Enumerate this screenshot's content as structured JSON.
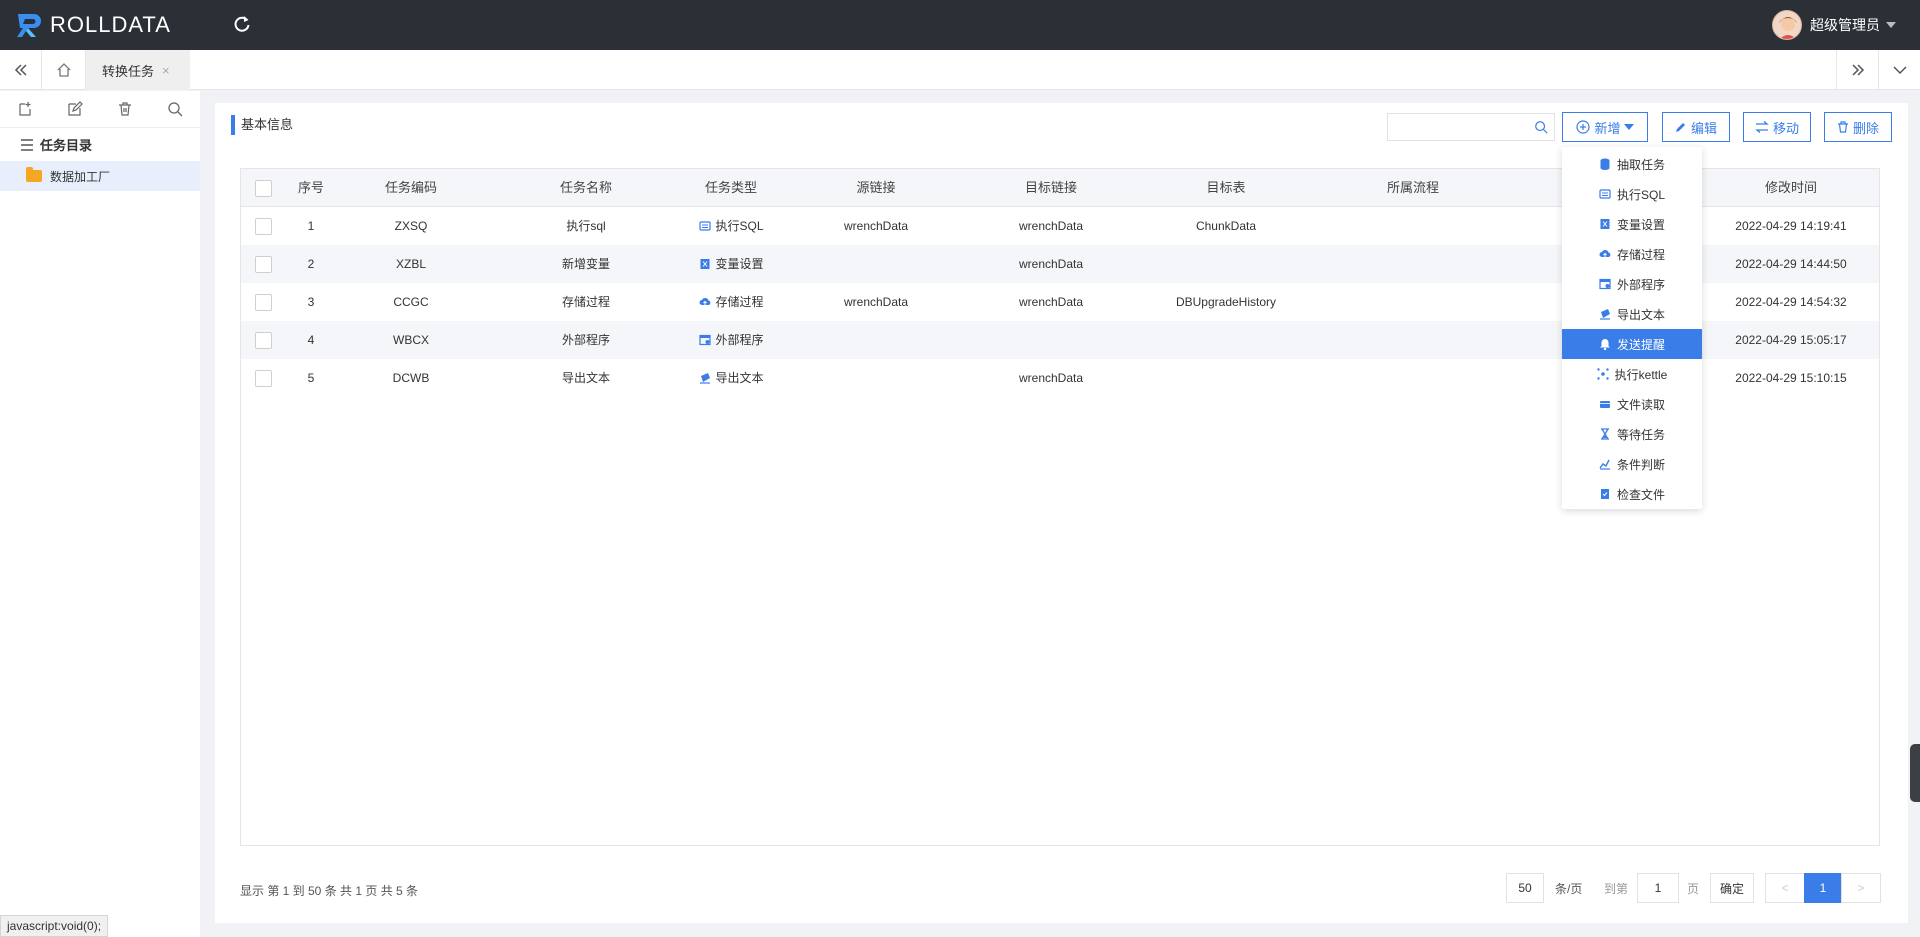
{
  "app": {
    "logo_text": "ROLLDATA",
    "user_name": "超级管理员"
  },
  "tabs": [
    {
      "label": "转换任务",
      "close": "×"
    }
  ],
  "sidebar": {
    "title": "任务目录",
    "items": [
      {
        "label": "数据加工厂"
      }
    ]
  },
  "panel": {
    "section_title": "基本信息"
  },
  "toolbar": {
    "add_label": "新增",
    "edit_label": "编辑",
    "move_label": "移动",
    "delete_label": "删除",
    "search_placeholder": ""
  },
  "table": {
    "headers": [
      "序号",
      "任务编码",
      "任务名称",
      "任务类型",
      "源链接",
      "目标链接",
      "目标表",
      "所属流程",
      "修改时间"
    ],
    "rows": [
      {
        "no": "1",
        "code": "ZXSQ",
        "name": "执行sql",
        "type": "执行SQL",
        "type_icon": "sql-icon",
        "source": "wrenchData",
        "target": "wrenchData",
        "table": "ChunkData",
        "flow": "",
        "time": "2022-04-29 14:19:41"
      },
      {
        "no": "2",
        "code": "XZBL",
        "name": "新增变量",
        "type": "变量设置",
        "type_icon": "variable-icon",
        "source": "",
        "target": "wrenchData",
        "table": "",
        "flow": "",
        "time": "2022-04-29 14:44:50"
      },
      {
        "no": "3",
        "code": "CCGC",
        "name": "存储过程",
        "type": "存储过程",
        "type_icon": "cloud-upload-icon",
        "source": "wrenchData",
        "target": "wrenchData",
        "table": "DBUpgradeHistory",
        "flow": "",
        "time": "2022-04-29 14:54:32"
      },
      {
        "no": "4",
        "code": "WBCX",
        "name": "外部程序",
        "type": "外部程序",
        "type_icon": "external-program-icon",
        "source": "",
        "target": "",
        "table": "",
        "flow": "",
        "time": "2022-04-29 15:05:17"
      },
      {
        "no": "5",
        "code": "DCWB",
        "name": "导出文本",
        "type": "导出文本",
        "type_icon": "export-text-icon",
        "source": "",
        "target": "wrenchData",
        "table": "",
        "flow": "",
        "time": "2022-04-29 15:10:15"
      }
    ]
  },
  "dropdown": {
    "items": [
      {
        "label": "抽取任务",
        "icon": "database-icon"
      },
      {
        "label": "执行SQL",
        "icon": "sql-icon"
      },
      {
        "label": "变量设置",
        "icon": "variable-icon"
      },
      {
        "label": "存储过程",
        "icon": "cloud-upload-icon"
      },
      {
        "label": "外部程序",
        "icon": "external-program-icon"
      },
      {
        "label": "导出文本",
        "icon": "export-text-icon"
      },
      {
        "label": "发送提醒",
        "icon": "bell-icon",
        "active": true
      },
      {
        "label": "执行kettle",
        "icon": "kettle-icon"
      },
      {
        "label": "文件读取",
        "icon": "file-read-icon"
      },
      {
        "label": "等待任务",
        "icon": "hourglass-icon"
      },
      {
        "label": "条件判断",
        "icon": "condition-icon"
      },
      {
        "label": "检查文件",
        "icon": "check-file-icon"
      }
    ]
  },
  "pager": {
    "info": "显示 第 1 到 50 条 共 1 页 共 5 条",
    "page_size": "50",
    "per_page_label": "条/页",
    "goto_label": "到第",
    "goto_value": "1",
    "page_unit": "页",
    "confirm_label": "确定",
    "prev": "<",
    "current": "1",
    "next": ">"
  },
  "status_bar": {
    "text": "javascript:void(0);"
  },
  "colors": {
    "accent": "#3a7de9",
    "topbar": "#2b2f36"
  }
}
